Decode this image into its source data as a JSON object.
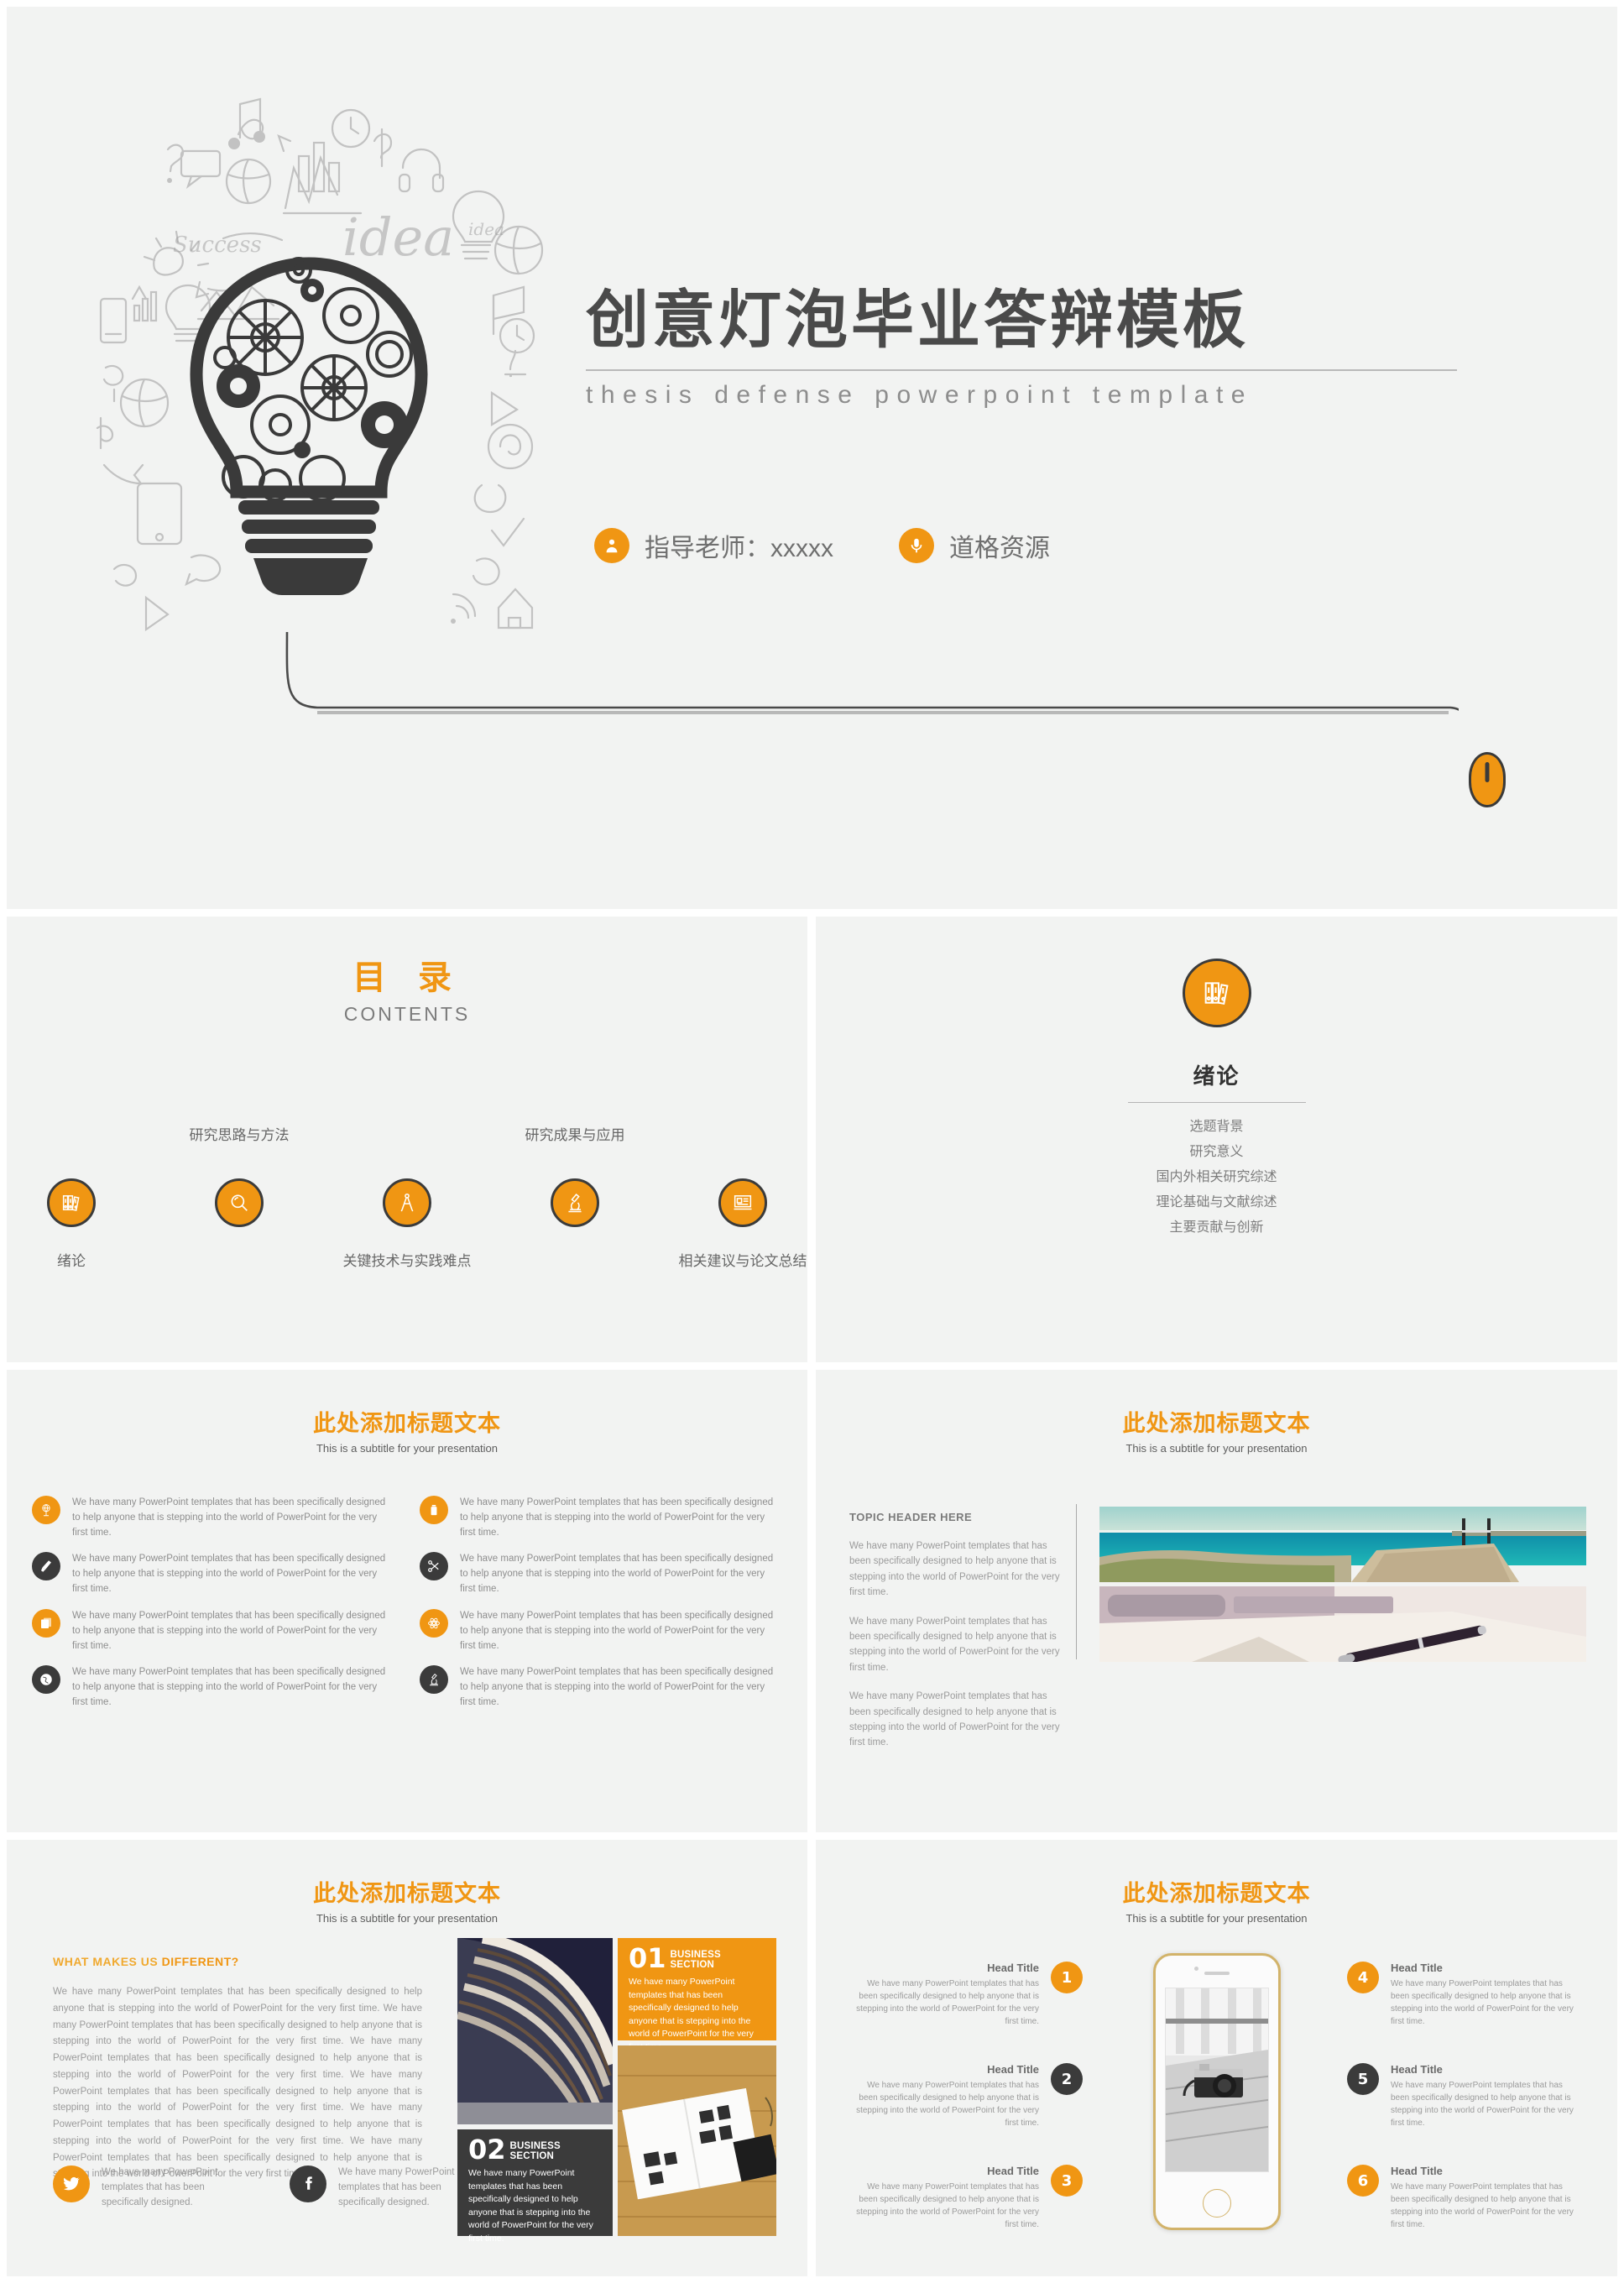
{
  "brand": {
    "orange": "#f09613",
    "dark": "#3b3b3b",
    "slide_bg": "#f2f3f2",
    "gap": "#ffffff"
  },
  "slide1": {
    "title": "创意灯泡毕业答辩模板",
    "subtitle": "thesis defense powerpoint template",
    "doodle_word": "idea",
    "meta": [
      {
        "icon": "person-icon",
        "text": "指导老师：xxxxx"
      },
      {
        "icon": "microphone-icon",
        "text": "道格资源"
      }
    ],
    "decor": {
      "bulb": "lightbulb-gears-graphic",
      "mouse": "computer-mouse-graphic"
    }
  },
  "slide2": {
    "heading_cn": "目 录",
    "heading_en": "CONTENTS",
    "items": [
      {
        "label": "绪论",
        "icon": "books-icon",
        "position": "below"
      },
      {
        "label": "研究思路与方法",
        "icon": "magnifier-icon",
        "position": "above"
      },
      {
        "label": "关键技术与实践难点",
        "icon": "compass-icon",
        "position": "below"
      },
      {
        "label": "研究成果与应用",
        "icon": "microscope-icon",
        "position": "above"
      },
      {
        "label": "相关建议与论文总结",
        "icon": "presentation-board-icon",
        "position": "below"
      }
    ]
  },
  "slide3": {
    "icon": "books-icon",
    "title": "绪论",
    "list": [
      "选题背景",
      "研究意义",
      "国内外相关研究综述",
      "理论基础与文献综述",
      "主要贡献与创新"
    ]
  },
  "slide4": {
    "title": "此处添加标题文本",
    "subtitle": "This is a subtitle for your presentation",
    "body_text": "We have many PowerPoint templates that has been specifically designed to help anyone that is stepping into the world of PowerPoint for the very first time.",
    "features": [
      {
        "icon": "globe-wire-icon",
        "color": "orange"
      },
      {
        "icon": "battery-icon",
        "color": "orange"
      },
      {
        "icon": "brush-icon",
        "color": "dark"
      },
      {
        "icon": "scissors-icon",
        "color": "dark"
      },
      {
        "icon": "folder-icon",
        "color": "orange"
      },
      {
        "icon": "atom-icon",
        "color": "orange"
      },
      {
        "icon": "earth-icon",
        "color": "dark"
      },
      {
        "icon": "microscope-icon",
        "color": "dark"
      }
    ]
  },
  "slide5": {
    "title": "此处添加标题文本",
    "subtitle": "This is a subtitle for your presentation",
    "topic_header": "TOPIC HEADER HERE",
    "paragraphs": [
      "We have many PowerPoint templates that has been specifically designed to help anyone that is stepping into the world of PowerPoint for the very first time.",
      "We have many PowerPoint templates that has been specifically designed to help anyone that is stepping into the world of PowerPoint for the very first time.",
      "We have many PowerPoint templates that has been specifically designed to help anyone that is stepping into the world of PowerPoint for the very first time."
    ],
    "photos": [
      "seaside-pier-photo",
      "pen-notebook-photo"
    ]
  },
  "slide6": {
    "title": "此处添加标题文本",
    "subtitle": "This is a subtitle for your presentation",
    "diff_head_plain": "WHAT MAKES US ",
    "diff_head_bold": "DIFFERENT?",
    "diff_body": "We have many PowerPoint templates that has been specifically designed to help anyone that is stepping into the world of PowerPoint for the very first time. We have many PowerPoint templates that has been specifically designed to help anyone that is stepping into the world of PowerPoint for the very first time. We have many PowerPoint templates that has been specifically designed to help anyone that is stepping into the world of PowerPoint for the very first time. We have many PowerPoint templates that has been specifically designed to help anyone that is stepping into the world of PowerPoint for the very first time. We have many PowerPoint templates that has been specifically designed to help anyone that is stepping into the world of PowerPoint for the very first time. We have many PowerPoint templates that has been specifically designed to help anyone that is stepping into the world of PowerPoint for the very first time.",
    "social": [
      {
        "icon": "twitter-icon",
        "color": "orange",
        "text": "We have many PowerPoint templates that has been specifically designed."
      },
      {
        "icon": "facebook-icon",
        "color": "dark",
        "text": "We have many PowerPoint templates that has been specifically designed."
      }
    ],
    "business": [
      {
        "number": "01",
        "label": "BUSINESS SECTION",
        "text": "We have many PowerPoint templates that has been specifically designed to help anyone that is stepping into the world of PowerPoint for the very first time.",
        "color": "orange"
      },
      {
        "number": "02",
        "label": "BUSINESS SECTION",
        "text": "We have many PowerPoint templates that has been specifically designed to help anyone that is stepping into the world of PowerPoint for the very first time.",
        "color": "dark"
      }
    ],
    "photos": [
      "library-shelves-photo",
      "open-book-wood-photo"
    ]
  },
  "slide7": {
    "title": "此处添加标题文本",
    "subtitle": "This is a subtitle for your presentation",
    "device": "smartphone-mockup",
    "screen_photo": "vintage-camera-photo",
    "items": [
      {
        "num": "1",
        "title": "Head Title",
        "body": "We have many PowerPoint templates that has been specifically designed to help anyone that is stepping into the world of PowerPoint for the very first time.",
        "color": "orange",
        "side": "left"
      },
      {
        "num": "2",
        "title": "Head Title",
        "body": "We have many PowerPoint templates that has been specifically designed to help anyone that is stepping into the world of PowerPoint for the very first time.",
        "color": "dark",
        "side": "left"
      },
      {
        "num": "3",
        "title": "Head Title",
        "body": "We have many PowerPoint templates that has been specifically designed to help anyone that is stepping into the world of PowerPoint for the very first time.",
        "color": "orange",
        "side": "left"
      },
      {
        "num": "4",
        "title": "Head Title",
        "body": "We have many PowerPoint templates that has been specifically designed to help anyone that is stepping into the world of PowerPoint for the very first time.",
        "color": "orange",
        "side": "right"
      },
      {
        "num": "5",
        "title": "Head Title",
        "body": "We have many PowerPoint templates that has been specifically designed to help anyone that is stepping into the world of PowerPoint for the very first time.",
        "color": "dark",
        "side": "right"
      },
      {
        "num": "6",
        "title": "Head Title",
        "body": "We have many PowerPoint templates that has been specifically designed to help anyone that is stepping into the world of PowerPoint for the very first time.",
        "color": "orange",
        "side": "right"
      }
    ]
  }
}
